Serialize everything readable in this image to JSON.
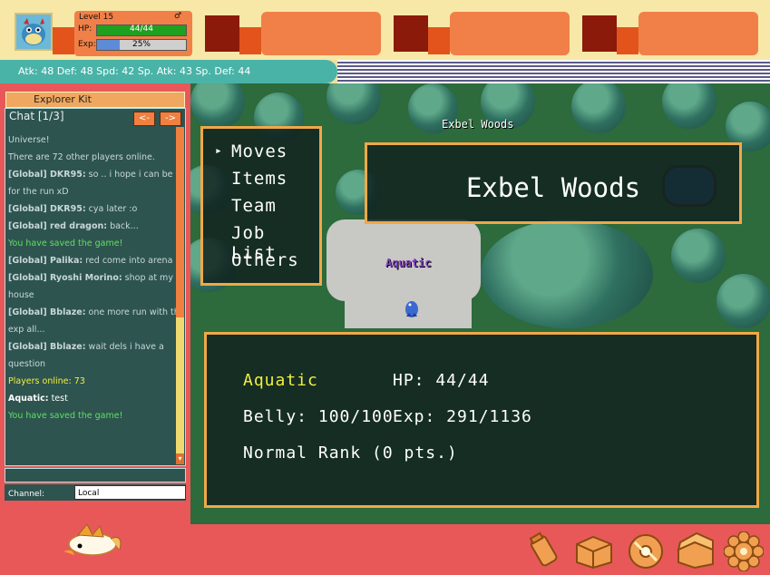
{
  "lead": {
    "level_label": "Level 15",
    "gender_symbol": "♂",
    "hp_label": "HP:",
    "hp_value": "44/44",
    "hp_fraction": 1.0,
    "exp_label": "Exp:",
    "exp_value": "25%",
    "exp_fraction": 0.25
  },
  "stats_line": "Atk: 48 Def: 48 Spd: 42 Sp. Atk: 43 Sp. Def: 44",
  "explorer_kit": {
    "title": "Explorer Kit"
  },
  "chat": {
    "title": "Chat [1/3]",
    "prev_label": "<-",
    "next_label": "->",
    "lines": [
      {
        "tag": "",
        "text": "Universe!",
        "color": "normal"
      },
      {
        "tag": "",
        "text": "There are 72 other players online.",
        "color": "normal"
      },
      {
        "tag": "[Global] DKR95:",
        "text": " so .. i hope i can be up",
        "color": "normal"
      },
      {
        "tag": "",
        "text": "for the run xD",
        "color": "normal"
      },
      {
        "tag": "[Global] DKR95:",
        "text": " cya later :o",
        "color": "normal"
      },
      {
        "tag": "[Global] red dragon:",
        "text": " back...",
        "color": "normal"
      },
      {
        "tag": "",
        "text": "You have saved the game!",
        "color": "green"
      },
      {
        "tag": "[Global] Palika:",
        "text": " red come into arena",
        "color": "normal"
      },
      {
        "tag": "[Global] Ryoshi Morino:",
        "text": " shop at my",
        "color": "normal"
      },
      {
        "tag": "",
        "text": "house",
        "color": "normal"
      },
      {
        "tag": "[Global] Bblaze:",
        "text": " one more run with this",
        "color": "normal"
      },
      {
        "tag": "",
        "text": "exp all...",
        "color": "normal"
      },
      {
        "tag": "[Global] Bblaze:",
        "text": " wait dels i have a",
        "color": "normal"
      },
      {
        "tag": "",
        "text": "question",
        "color": "normal"
      },
      {
        "tag": "",
        "text": "Players online: 73",
        "color": "yellow"
      },
      {
        "tag": "Aquatic:",
        "text": " test",
        "color": "white"
      },
      {
        "tag": "",
        "text": "You have saved the game!",
        "color": "green"
      }
    ],
    "channel_label": "Channel:",
    "channel_value": "Local"
  },
  "game": {
    "location_label": "Exbel Woods",
    "location_banner": "Exbel Woods",
    "player_name": "Aquatic",
    "menu": {
      "cursor": "▸",
      "items": [
        "Moves",
        "Items",
        "Team",
        "Job List",
        "Others"
      ]
    },
    "status": {
      "name": "Aquatic",
      "hp": "HP: 44/44",
      "belly": "Belly: 100/100",
      "exp": "Exp: 291/1136",
      "rank": "Normal Rank (0 pts.)"
    }
  },
  "colors": {
    "accent": "#f08048",
    "panel": "#e85858",
    "chat_bg": "#2e5450",
    "menu_border": "#f0a848",
    "name_yellow": "#f0f040"
  },
  "bottom_icons": [
    "bag-icon",
    "storage-box-icon",
    "disc-icon",
    "chest-icon",
    "gear-flower-icon"
  ]
}
